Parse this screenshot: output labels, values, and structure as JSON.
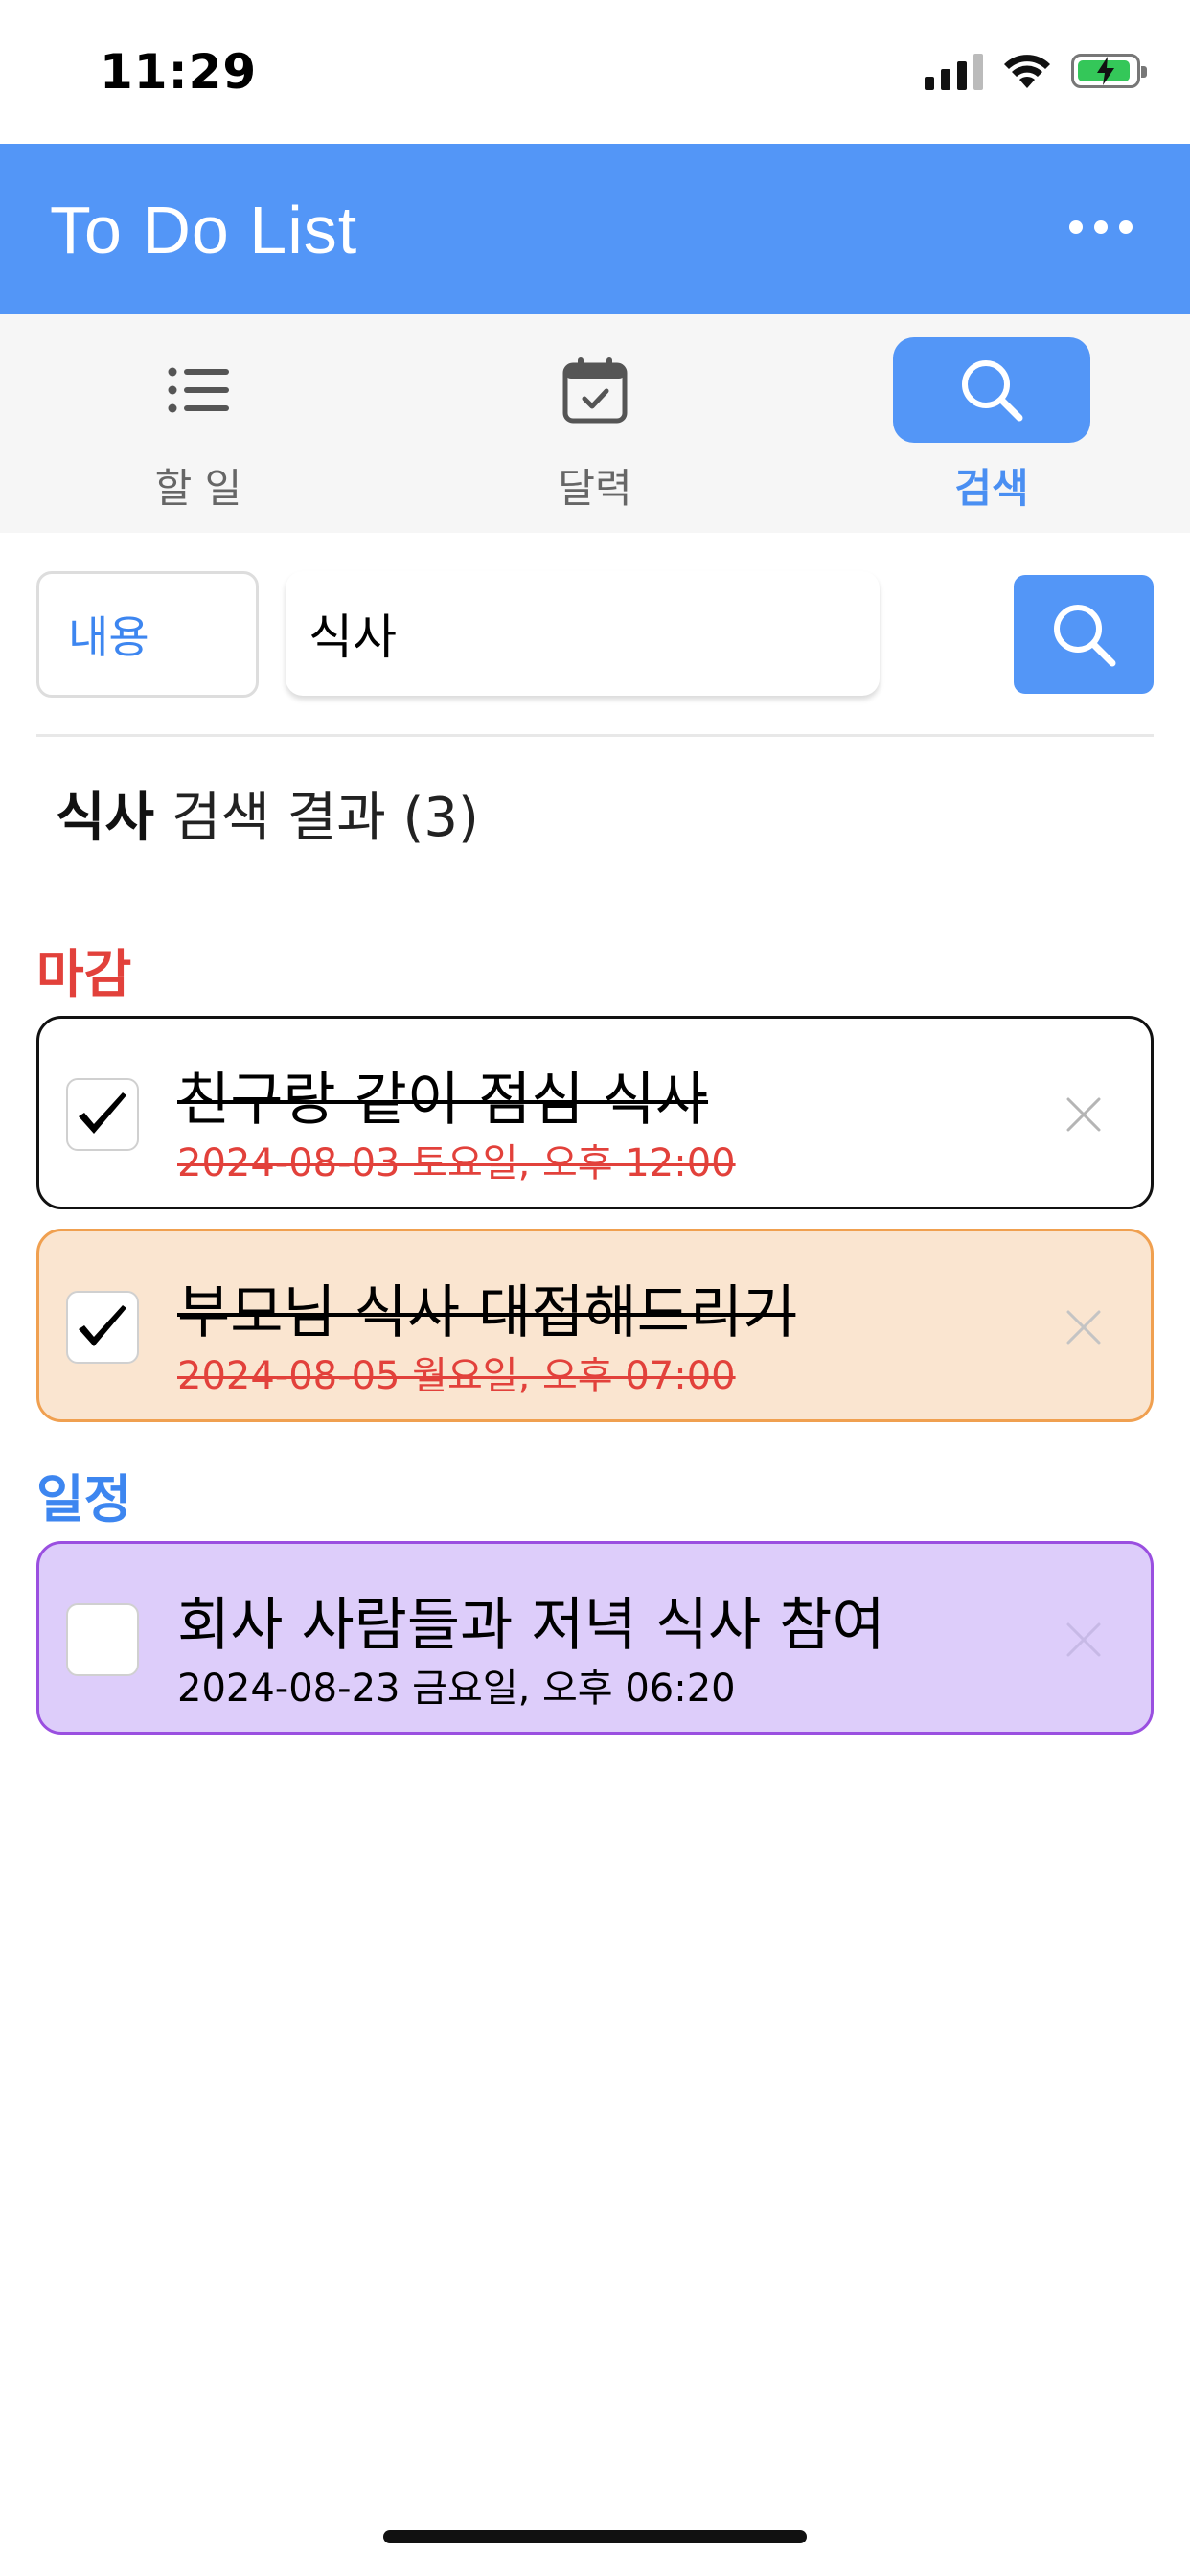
{
  "status_bar": {
    "time": "11:29"
  },
  "header": {
    "title": "To Do List"
  },
  "tabs": [
    {
      "label": "할 일",
      "icon": "list-icon",
      "active": false
    },
    {
      "label": "달력",
      "icon": "calendar-icon",
      "active": false
    },
    {
      "label": "검색",
      "icon": "search-icon",
      "active": true
    }
  ],
  "search": {
    "filter_value": "내용",
    "query": "식사"
  },
  "results": {
    "keyword": "식사",
    "summary": "검색 결과 (3)"
  },
  "sections": {
    "deadline": {
      "title": "마감",
      "color": "#e2413b"
    },
    "schedule": {
      "title": "일정",
      "color": "#3d86f0"
    }
  },
  "deadline_items": [
    {
      "title": "친구랑 같이 점심 식사",
      "date": "2024-08-03 토요일, 오후 12:00",
      "done": true,
      "bg": "#ffffff",
      "border": "#111111"
    },
    {
      "title": "부모님 식사 대접해드리기",
      "date": "2024-08-05 월요일, 오후 07:00",
      "done": true,
      "bg": "#fae5d0",
      "border": "#f0a050"
    }
  ],
  "schedule_items": [
    {
      "title": "회사 사람들과 저녁 식사 참여",
      "date": "2024-08-23 금요일, 오후 06:20",
      "done": false,
      "bg": "#ddcdfa",
      "border": "#9a4fe0"
    }
  ],
  "colors": {
    "accent": "#5396f7"
  }
}
